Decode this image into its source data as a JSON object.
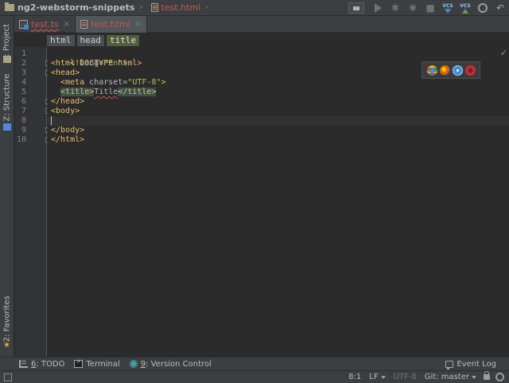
{
  "navbar": {
    "project": "ng2-webstorm-snippets",
    "file": "test.html"
  },
  "toolbar": {
    "icons": [
      "run-config-dropdown",
      "run-icon",
      "debug-icon",
      "coverage-icon",
      "stop-icon",
      "vcs-update-icon",
      "vcs-commit-icon",
      "settings-icon",
      "undo-icon"
    ],
    "vcs_update_label": "VCS",
    "vcs_commit_label": "VCS"
  },
  "left_strip": {
    "project": "1: Project",
    "structure": "Z: Structure",
    "favorites": "2: Favorites"
  },
  "tabs": [
    {
      "label": "test.ts",
      "active": false
    },
    {
      "label": "test.html",
      "active": true
    }
  ],
  "tab_close": "×",
  "breadcrumbs": [
    "html",
    "head",
    "title"
  ],
  "line_numbers": [
    "1",
    "2",
    "3",
    "4",
    "5",
    "6",
    "7",
    "8",
    "9",
    "10"
  ],
  "code": {
    "l1_tag": "<!DOCTYPE html>",
    "l2_open": "<html ",
    "l2_attr": "lang=",
    "l2_val": "\"en\"",
    "l2_close": ">",
    "l3": "<head>",
    "l4_indent": "  ",
    "l4_open": "<meta ",
    "l4_attr": "charset=",
    "l4_val": "\"UTF-8\"",
    "l4_close": ">",
    "l5_indent": "  ",
    "l5_open": "<title>",
    "l5_text": "Title",
    "l5_close": "</title>",
    "l6": "</head>",
    "l7": "<body>",
    "l9": "</body>",
    "l10": "</html>"
  },
  "browsers": [
    "chrome-icon",
    "firefox-icon",
    "safari-icon",
    "opera-icon"
  ],
  "bottom_tools": {
    "todo_num": "6",
    "todo_label": ": TODO",
    "terminal": "Terminal",
    "vc_num": "9",
    "vc_label": ": Version Control",
    "event_log": "Event Log"
  },
  "status": {
    "position": "8:1",
    "line_sep": "LF",
    "encoding": "UTF-8",
    "git": "Git: master"
  },
  "colors": {
    "background": "#2b2b2b",
    "chrome": "#3c3f41",
    "tag": "#e8bf6a",
    "string": "#a5c25c",
    "error": "#c75450"
  }
}
